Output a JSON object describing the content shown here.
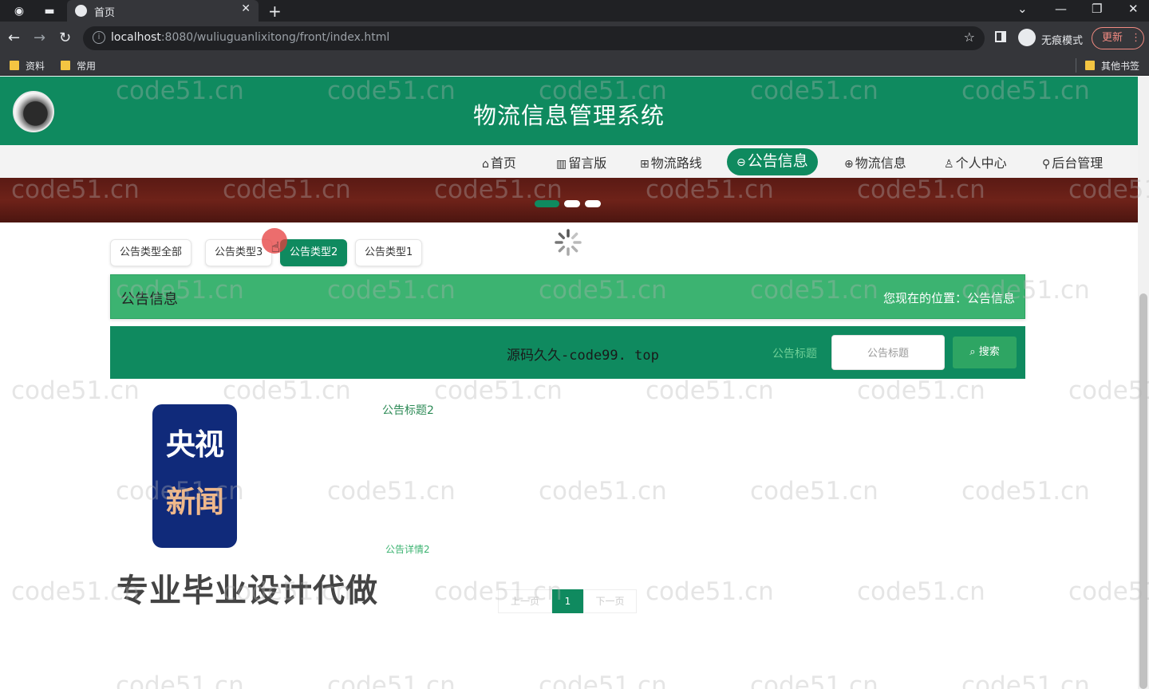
{
  "browser": {
    "tab_title": "首页",
    "url_host": "localhost",
    "url_rest": ":8080/wuliuguanlixitong/front/index.html",
    "incognito_label": "无痕模式",
    "update_label": "更新",
    "bookmarks": [
      {
        "label": "资料"
      },
      {
        "label": "常用"
      },
      {
        "label": "其他书签"
      }
    ]
  },
  "site": {
    "title": "物流信息管理系统"
  },
  "nav": [
    {
      "icon": "⌂",
      "label": "首页"
    },
    {
      "icon": "▥",
      "label": "留言版"
    },
    {
      "icon": "⊞",
      "label": "物流路线"
    },
    {
      "icon": "⊖",
      "label": "公告信息",
      "active": true
    },
    {
      "icon": "⊕",
      "label": "物流信息"
    },
    {
      "icon": "♙",
      "label": "个人中心"
    },
    {
      "icon": "⚲",
      "label": "后台管理"
    }
  ],
  "filters": [
    {
      "label": "公告类型全部"
    },
    {
      "label": "公告类型3"
    },
    {
      "label": "公告类型2",
      "active": true
    },
    {
      "label": "公告类型1"
    }
  ],
  "crumb": {
    "title": "公告信息",
    "location": "您现在的位置：公告信息"
  },
  "search": {
    "watermark_text": "源码久久-code99. top",
    "label": "公告标题",
    "placeholder": "公告标题",
    "button": "搜索"
  },
  "news_logo": {
    "line1": "央视",
    "line2": "新闻"
  },
  "promo": "专业毕业设计代做",
  "list": [
    {
      "title": "公告标题2",
      "detail": "公告详情2"
    }
  ],
  "pager": {
    "prev": "上一页",
    "current": "1",
    "next": "下一页"
  },
  "watermark": "code51.cn",
  "colors": {
    "primary": "#0f8a5f",
    "crumb": "#3cb371",
    "banner": "#5a1a14"
  }
}
